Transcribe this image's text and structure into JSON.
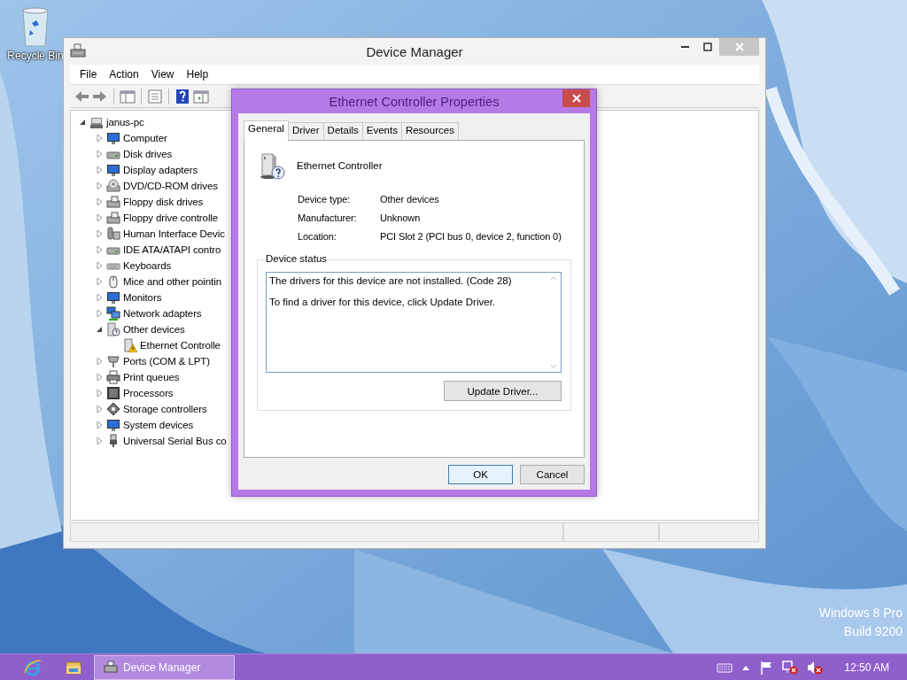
{
  "desktop_icons": [
    {
      "label": "Recycle Bin"
    }
  ],
  "device_manager": {
    "title": "Device Manager",
    "menu": [
      "File",
      "Action",
      "View",
      "Help"
    ],
    "tree": {
      "label": "janus-pc",
      "expanded": true,
      "children": [
        {
          "label": "Computer",
          "expanded": false
        },
        {
          "label": "Disk drives",
          "expanded": false
        },
        {
          "label": "Display adapters",
          "expanded": false
        },
        {
          "label": "DVD/CD-ROM drives",
          "expanded": false
        },
        {
          "label": "Floppy disk drives",
          "expanded": false
        },
        {
          "label": "Floppy drive controlle",
          "expanded": false
        },
        {
          "label": "Human Interface Devic",
          "expanded": false
        },
        {
          "label": "IDE ATA/ATAPI contro",
          "expanded": false
        },
        {
          "label": "Keyboards",
          "expanded": false
        },
        {
          "label": "Mice and other pointin",
          "expanded": false
        },
        {
          "label": "Monitors",
          "expanded": false
        },
        {
          "label": "Network adapters",
          "expanded": false
        },
        {
          "label": "Other devices",
          "expanded": true,
          "children": [
            {
              "label": "Ethernet Controlle"
            }
          ]
        },
        {
          "label": "Ports (COM & LPT)",
          "expanded": false
        },
        {
          "label": "Print queues",
          "expanded": false
        },
        {
          "label": "Processors",
          "expanded": false
        },
        {
          "label": "Storage controllers",
          "expanded": false
        },
        {
          "label": "System devices",
          "expanded": false
        },
        {
          "label": "Universal Serial Bus co",
          "expanded": false
        }
      ]
    }
  },
  "dialog": {
    "title": "Ethernet Controller Properties",
    "tabs": [
      {
        "label": "General",
        "selected": true
      },
      {
        "label": "Driver",
        "selected": false
      },
      {
        "label": "Details",
        "selected": false
      },
      {
        "label": "Events",
        "selected": false
      },
      {
        "label": "Resources",
        "selected": false
      }
    ],
    "device_name": "Ethernet Controller",
    "properties": [
      {
        "label": "Device type:",
        "value": "Other devices"
      },
      {
        "label": "Manufacturer:",
        "value": "Unknown"
      },
      {
        "label": "Location:",
        "value": "PCI Slot 2 (PCI bus 0, device 2, function 0)"
      }
    ],
    "status": {
      "legend": "Device status",
      "lines": [
        "The drivers for this device are not installed. (Code 28)",
        "To find a driver for this device, click Update Driver."
      ],
      "button": "Update Driver..."
    },
    "buttons": [
      {
        "label": "OK",
        "default": true
      },
      {
        "label": "Cancel",
        "default": false
      }
    ]
  },
  "edition": [
    "Windows 8 Pro",
    "Build 9200"
  ],
  "taskbar": {
    "windows": [
      {
        "label": "Device Manager",
        "selected": true
      }
    ],
    "clock": "12:50 AM"
  }
}
